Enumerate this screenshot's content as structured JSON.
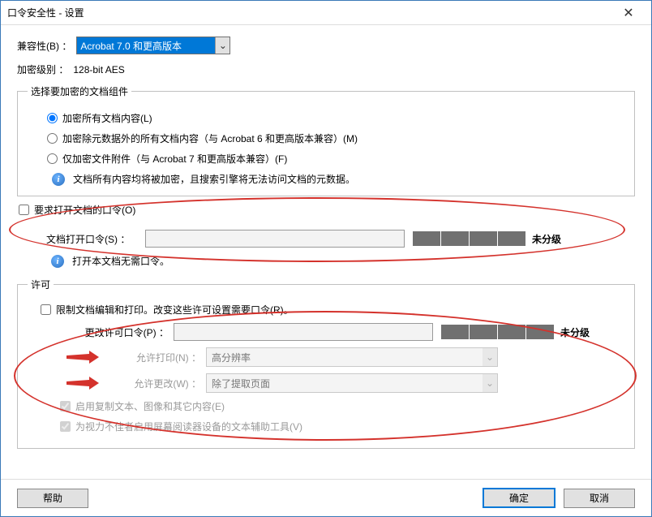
{
  "titlebar": {
    "title": "口令安全性 - 设置"
  },
  "compat": {
    "label": "兼容性(B) ：",
    "selected": "Acrobat 7.0 和更高版本"
  },
  "enc_level": {
    "label": "加密级别 ：",
    "value": "128-bit AES"
  },
  "components": {
    "legend": "选择要加密的文档组件",
    "opt1": "加密所有文档内容(L)",
    "opt2": "加密除元数据外的所有文档内容（与 Acrobat 6 和更高版本兼容）(M)",
    "opt3": "仅加密文件附件（与 Acrobat 7 和更高版本兼容）(F)",
    "info": "文档所有内容均将被加密，且搜索引擎将无法访问文档的元数据。"
  },
  "open_pw": {
    "check": "要求打开文档的口令(O)",
    "label": "文档打开口令(S) ：",
    "rating": "未分级",
    "info": "打开本文档无需口令。"
  },
  "permissions": {
    "legend": "许可",
    "restrict": "限制文档编辑和打印。改变这些许可设置需要口令(R)。",
    "change_pw_label": "更改许可口令(P) ：",
    "change_rating": "未分级",
    "print_label": "允许打印(N) ：",
    "print_value": "高分辨率",
    "change_label": "允许更改(W) ：",
    "change_value": "除了提取页面",
    "copy": "启用复制文本、图像和其它内容(E)",
    "reader": "为视力不佳者启用屏幕阅读器设备的文本辅助工具(V)"
  },
  "buttons": {
    "help": "帮助",
    "ok": "确定",
    "cancel": "取消"
  }
}
